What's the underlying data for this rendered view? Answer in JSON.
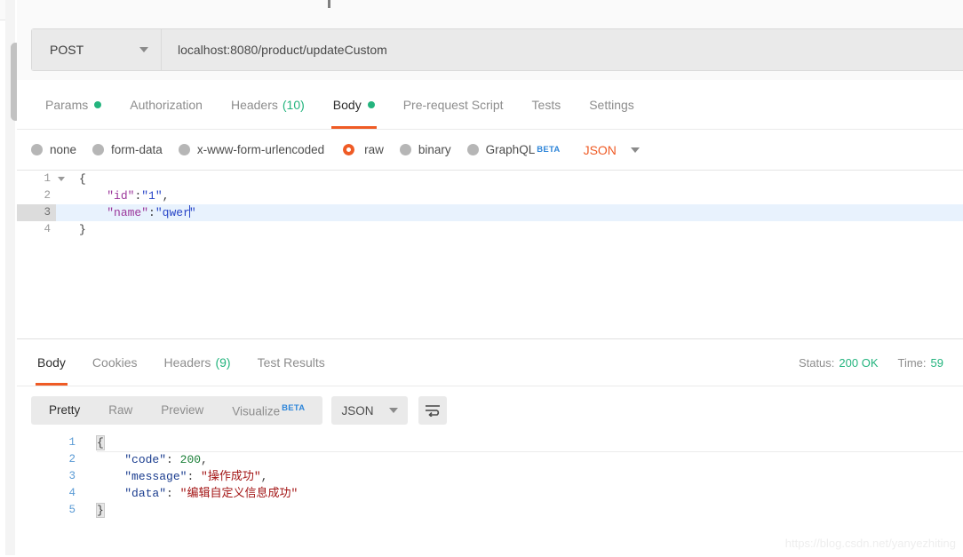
{
  "request": {
    "method": "POST",
    "url": "localhost:8080/product/updateCustom",
    "tabs": [
      {
        "label": "Params",
        "indicator": "dot",
        "active": false
      },
      {
        "label": "Authorization",
        "indicator": "none",
        "active": false
      },
      {
        "label": "Headers",
        "count": "(10)",
        "indicator": "count",
        "active": false
      },
      {
        "label": "Body",
        "indicator": "dot",
        "active": true
      },
      {
        "label": "Pre-request Script",
        "indicator": "none",
        "active": false
      },
      {
        "label": "Tests",
        "indicator": "none",
        "active": false
      },
      {
        "label": "Settings",
        "indicator": "none",
        "active": false
      }
    ],
    "body_types": [
      {
        "label": "none",
        "selected": false
      },
      {
        "label": "form-data",
        "selected": false
      },
      {
        "label": "x-www-form-urlencoded",
        "selected": false
      },
      {
        "label": "raw",
        "selected": true
      },
      {
        "label": "binary",
        "selected": false
      },
      {
        "label": "GraphQL",
        "selected": false,
        "badge": "BETA"
      }
    ],
    "language": "JSON",
    "editor": {
      "lines": [
        {
          "num": "1",
          "foldable": true,
          "active": false
        },
        {
          "num": "2",
          "foldable": false,
          "active": false
        },
        {
          "num": "3",
          "foldable": false,
          "active": true
        },
        {
          "num": "4",
          "foldable": false,
          "active": false
        }
      ],
      "line1_open": "{",
      "line2_key": "\"id\"",
      "line2_colon": ":",
      "line2_value": "\"1\"",
      "line2_comma": ",",
      "line3_key": "\"name\"",
      "line3_colon": ":",
      "line3_value": "\"qwer",
      "line3_value_end": "\"",
      "line4_close": "}"
    }
  },
  "response": {
    "tabs": [
      {
        "label": "Body",
        "indicator": "none",
        "active": true
      },
      {
        "label": "Cookies",
        "indicator": "none",
        "active": false
      },
      {
        "label": "Headers",
        "count": "(9)",
        "indicator": "count",
        "active": false
      },
      {
        "label": "Test Results",
        "indicator": "none",
        "active": false
      }
    ],
    "status_label": "Status:",
    "status_value": "200 OK",
    "time_label": "Time:",
    "time_value": "59",
    "view_modes": [
      {
        "label": "Pretty",
        "active": true
      },
      {
        "label": "Raw",
        "active": false
      },
      {
        "label": "Preview",
        "active": false
      },
      {
        "label": "Visualize",
        "active": false,
        "badge": "BETA"
      }
    ],
    "format": "JSON",
    "body": {
      "lines": [
        "1",
        "2",
        "3",
        "4",
        "5"
      ],
      "line1_open": "{",
      "line2_key": "\"code\"",
      "line2_colon": ": ",
      "line2_value": "200",
      "line2_comma": ",",
      "line3_key": "\"message\"",
      "line3_colon": ": ",
      "line3_value": "\"操作成功\"",
      "line3_comma": ",",
      "line4_key": "\"data\"",
      "line4_colon": ": ",
      "line4_value": "\"编辑自定义信息成功\"",
      "line5_close": "}"
    }
  },
  "watermark": "https://blog.csdn.net/yanyezhiting",
  "colors": {
    "accent": "#ef5b25",
    "success": "#24b47e",
    "beta": "#2f86d9",
    "active_line": "#e8f2fd"
  }
}
